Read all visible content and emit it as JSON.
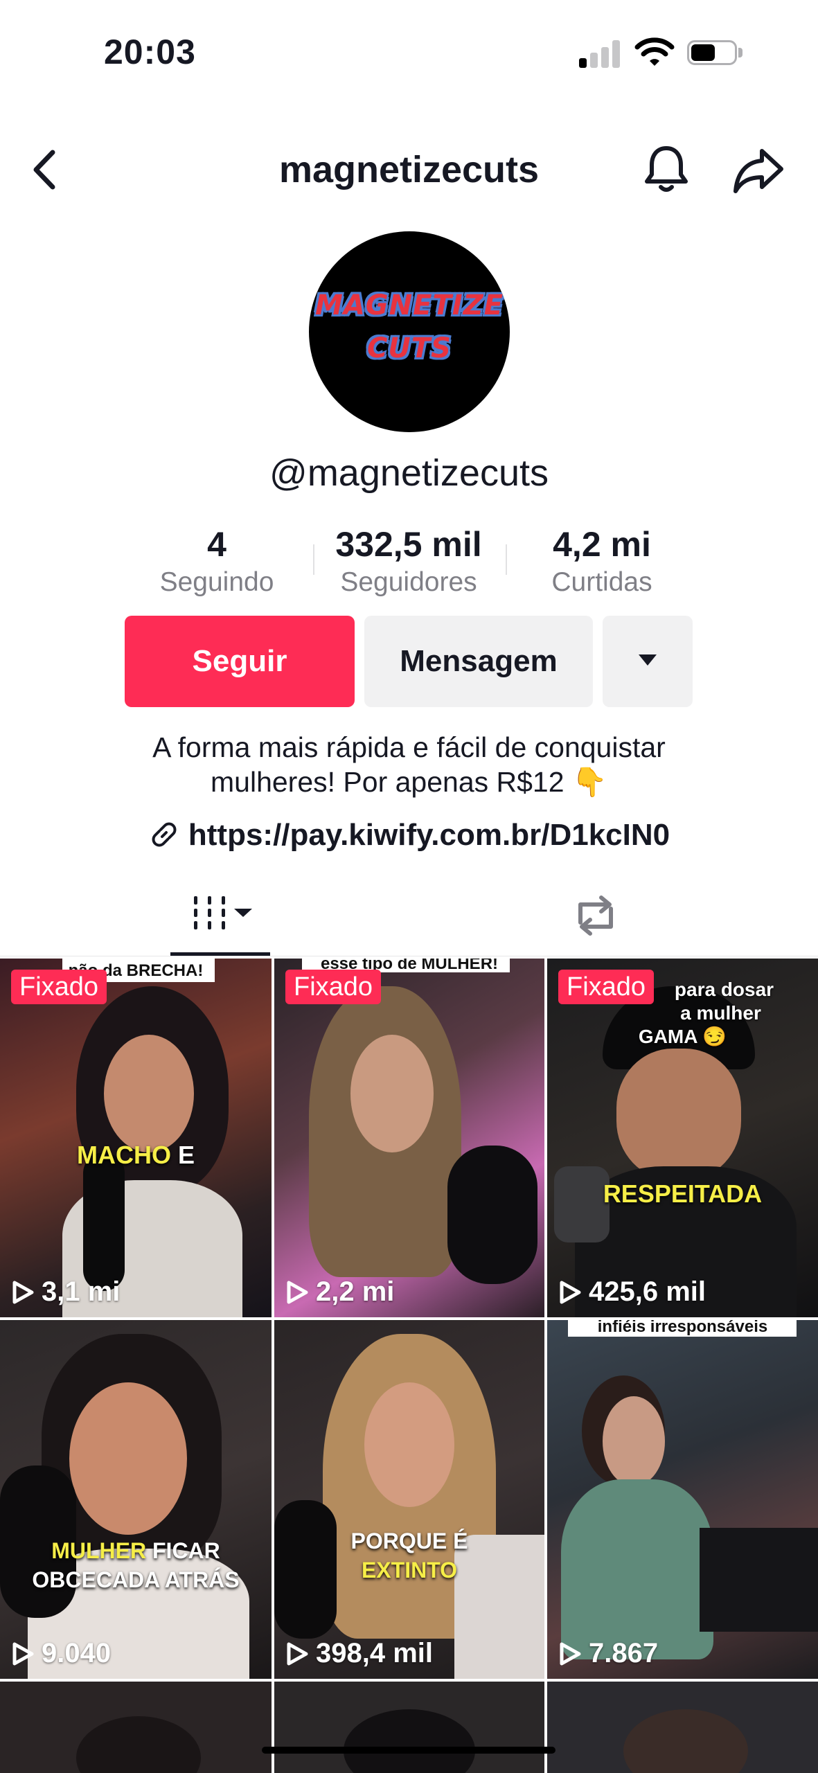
{
  "status_bar": {
    "time": "20:03"
  },
  "header": {
    "title": "magnetizecuts"
  },
  "profile": {
    "avatar_logo_line1": "MAGNETIZE",
    "avatar_logo_line2": "CUTS",
    "handle": "@magnetizecuts",
    "stats": [
      {
        "value": "4",
        "label": "Seguindo"
      },
      {
        "value": "332,5 mil",
        "label": "Seguidores"
      },
      {
        "value": "4,2 mi",
        "label": "Curtidas"
      }
    ],
    "follow_label": "Seguir",
    "message_label": "Mensagem",
    "bio_line1": "A forma mais rápida e fácil de conquistar",
    "bio_line2": "mulheres! Por apenas R$12 👇",
    "link": "https://pay.kiwify.com.br/D1kcIN0"
  },
  "tabs": [
    {
      "name": "videos-grid-tab",
      "icon": "grid-icon"
    },
    {
      "name": "reposts-tab",
      "icon": "repost-icon"
    }
  ],
  "videos": [
    {
      "pinned": "Fixado",
      "views": "3,1 mi",
      "top_text": "não da BRECHA!",
      "cap1": "MACHO",
      "cap1b": " E",
      "cap2": ""
    },
    {
      "pinned": "Fixado",
      "views": "2,2 mi",
      "top_text": "esse tipo de MULHER!",
      "cap1": "",
      "cap1b": "",
      "cap2": ""
    },
    {
      "pinned": "Fixado",
      "views": "425,6 mil",
      "top_text": "",
      "cap1": "RESPEITADA",
      "cap1b": "",
      "cap2": "",
      "overlay1": "para dosar",
      "overlay2": "a mulher",
      "overlay3": "GAMA 😏"
    },
    {
      "pinned": "",
      "views": "9.040",
      "top_text": "",
      "cap1": "MULHER",
      "cap1b": " FICAR",
      "cap2": "OBCECADA ATRÁS"
    },
    {
      "pinned": "",
      "views": "398,4 mil",
      "top_text": "",
      "cap1": "PORQUE É",
      "cap1b": "",
      "cap2": "EXTINTO"
    },
    {
      "pinned": "",
      "views": "7.867",
      "top_text": "infiéis irresponsáveis",
      "cap1": "",
      "cap1b": "",
      "cap2": ""
    }
  ],
  "colors": {
    "accent": "#fe2c55",
    "secondary_button": "#f1f1f2",
    "muted_text": "#7f7f86"
  }
}
